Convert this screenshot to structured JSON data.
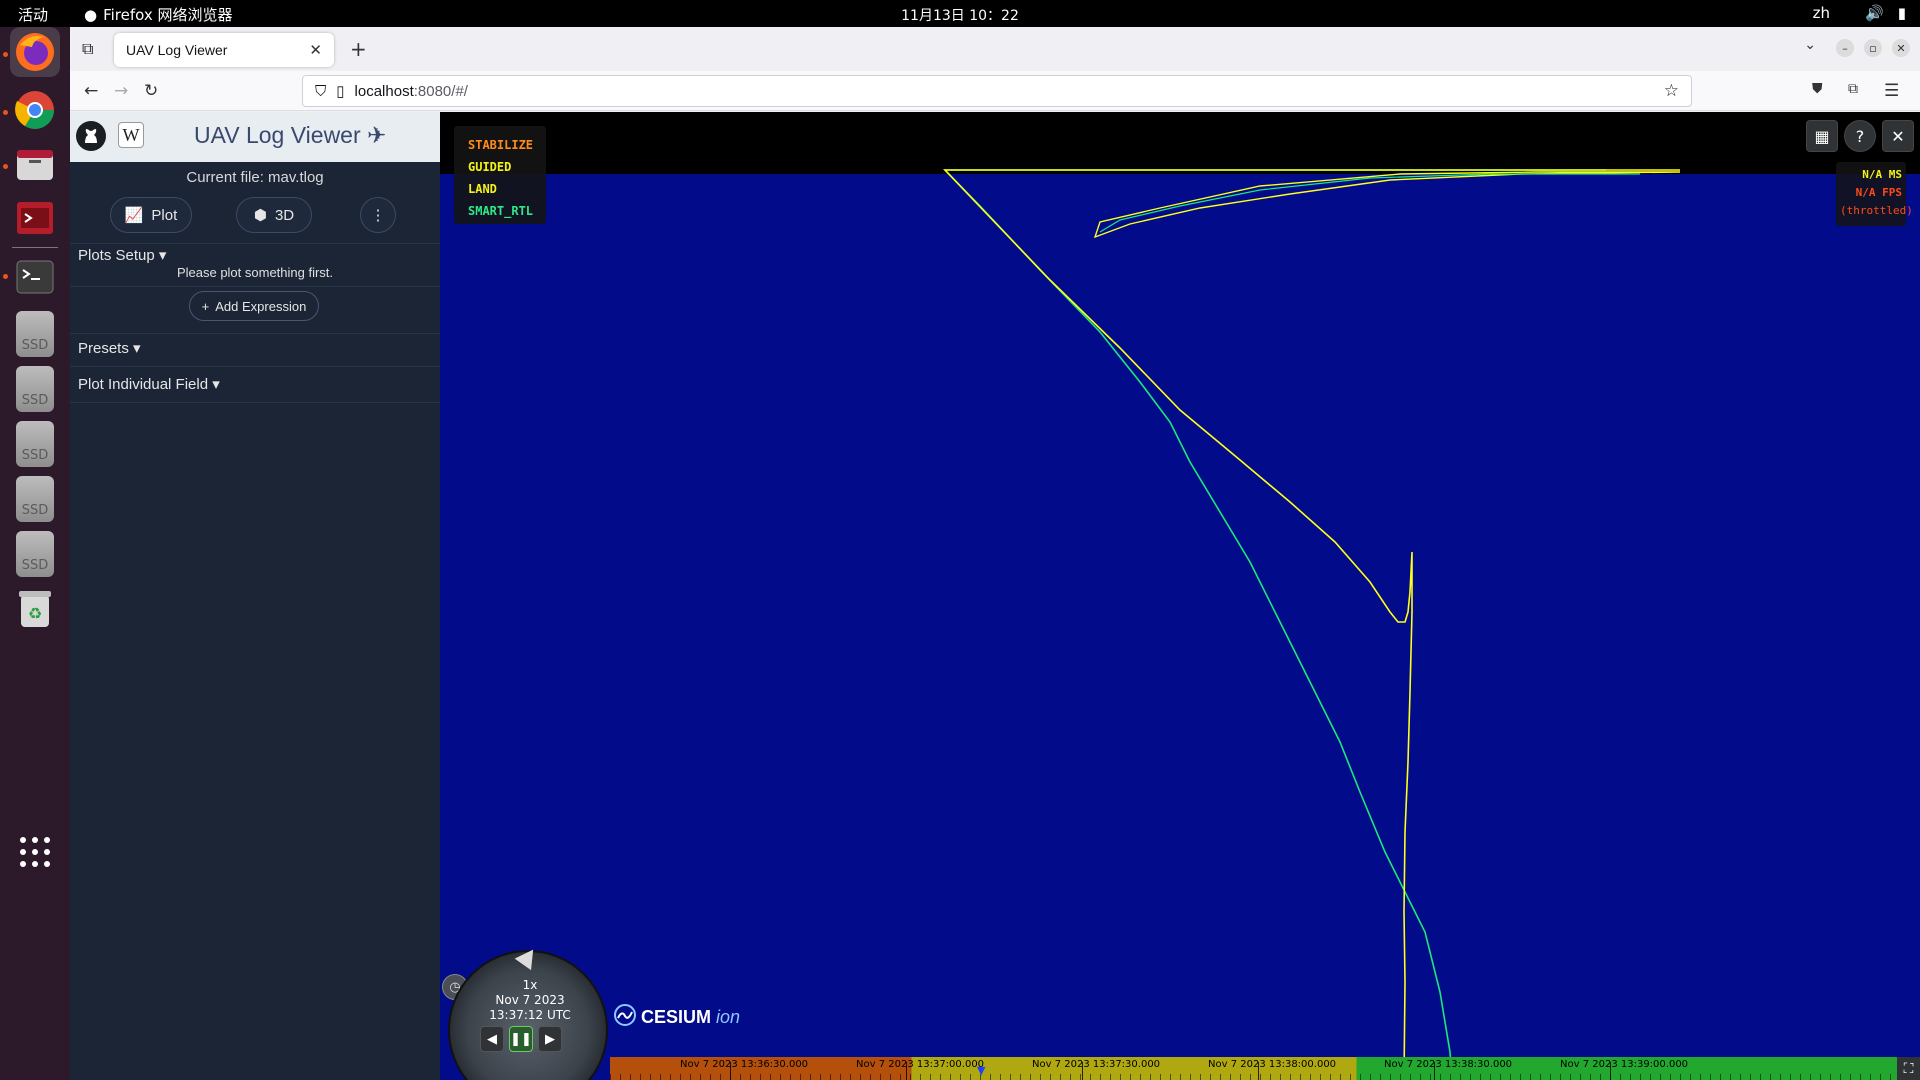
{
  "topbar": {
    "activities": "活动",
    "app_name": "Firefox 网络浏览器",
    "clock": "11月13日  10：22",
    "lang": "zh"
  },
  "dock": {
    "items": [
      "firefox-icon",
      "chrome-icon",
      "files-icon",
      "app-red-icon",
      "terminal-icon",
      "ssd-drive-icon",
      "ssd-drive-icon",
      "ssd-drive-icon",
      "ssd-drive-icon",
      "ssd-drive-icon",
      "trash-icon",
      "app-grid-icon"
    ],
    "ssd_label": "SSD"
  },
  "browser": {
    "tab_title": "UAV Log Viewer",
    "url_host": "localhost",
    "url_path": ":8080/#/"
  },
  "sidebar": {
    "title": "UAV Log Viewer",
    "wiki_letter": "W",
    "current_file": "Current file: mav.tlog",
    "plot_button": "Plot",
    "threed_button": "3D",
    "plots_setup": "Plots Setup",
    "hint": "Please plot something first.",
    "add_expression": "Add Expression",
    "presets": "Presets",
    "plot_individual_field": "Plot Individual Field"
  },
  "viewer": {
    "modes": [
      {
        "label": "STABILIZE",
        "color": "#ff8c1a"
      },
      {
        "label": "GUIDED",
        "color": "#f2f21a"
      },
      {
        "label": "LAND",
        "color": "#f2f21a"
      },
      {
        "label": "SMART_RTL",
        "color": "#2ee88a"
      }
    ],
    "perf": {
      "ms": "N/A MS",
      "fps": "N/A FPS",
      "throttled": "(throttled)"
    },
    "animation": {
      "speed": "1x",
      "date": "Nov 7 2023",
      "time": "13:37:12 UTC"
    },
    "credit": {
      "brand": "CESIUM",
      "ion": "ion"
    },
    "timeline_labels": [
      "Nov 7 2023 13:36:30.000",
      "Nov 7 2023 13:37:00.000",
      "Nov 7 2023 13:37:30.000",
      "Nov 7 2023 13:38:00.000",
      "Nov 7 2023 13:38:30.000",
      "Nov 7 2023 13:39:00.000"
    ],
    "colors": {
      "background": "#020b8a",
      "track_yellow": "#ffff1a",
      "track_green": "#1ae87a"
    }
  }
}
